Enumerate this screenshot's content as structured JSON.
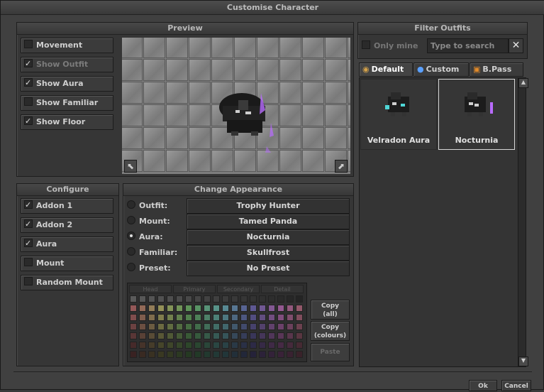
{
  "window": {
    "title": "Customise Character"
  },
  "preview": {
    "title": "Preview",
    "options": [
      {
        "label": "Movement",
        "checked": false,
        "enabled": true
      },
      {
        "label": "Show Outfit",
        "checked": true,
        "enabled": false
      },
      {
        "label": "Show Aura",
        "checked": true,
        "enabled": true
      },
      {
        "label": "Show Familiar",
        "checked": false,
        "enabled": true
      },
      {
        "label": "Show Floor",
        "checked": true,
        "enabled": true
      }
    ]
  },
  "configure": {
    "title": "Configure",
    "options": [
      {
        "label": "Addon 1",
        "checked": true
      },
      {
        "label": "Addon 2",
        "checked": true
      },
      {
        "label": "Aura",
        "checked": true
      },
      {
        "label": "Mount",
        "checked": false
      },
      {
        "label": "Random Mount",
        "checked": false
      }
    ]
  },
  "appearance": {
    "title": "Change Appearance",
    "rows": [
      {
        "label": "Outfit:",
        "value": "Trophy Hunter",
        "selected": false
      },
      {
        "label": "Mount:",
        "value": "Tamed Panda",
        "selected": false
      },
      {
        "label": "Aura:",
        "value": "Nocturnia",
        "selected": true
      },
      {
        "label": "Familiar:",
        "value": "Skullfrost",
        "selected": false
      },
      {
        "label": "Preset:",
        "value": "No Preset",
        "selected": false
      }
    ],
    "color_tabs": [
      "Head",
      "Primary",
      "Secondary",
      "Detail"
    ],
    "copy_all": "Copy\n(all)",
    "copy_all_l1": "Copy",
    "copy_all_l2": "(all)",
    "copy_colours_l1": "Copy",
    "copy_colours_l2": "(colours)",
    "paste": "Paste"
  },
  "filter": {
    "title": "Filter Outfits",
    "only_mine": "Only mine",
    "search_placeholder": "Type to search",
    "clear_icon": "close-icon"
  },
  "tabs": [
    {
      "label": "Default",
      "icon": "coin-icon",
      "active": true
    },
    {
      "label": "Custom",
      "icon": "orb-icon",
      "active": false
    },
    {
      "label": "B.Pass",
      "icon": "pass-icon",
      "active": false
    }
  ],
  "outfits": [
    {
      "name": "Velradon Aura",
      "selected": false
    },
    {
      "name": "Nocturnia",
      "selected": true
    }
  ],
  "footer": {
    "ok": "Ok",
    "cancel": "Cancel"
  },
  "colors": {
    "accent_aura": "#b86bff",
    "cyan_aura": "#4fd6d6"
  }
}
